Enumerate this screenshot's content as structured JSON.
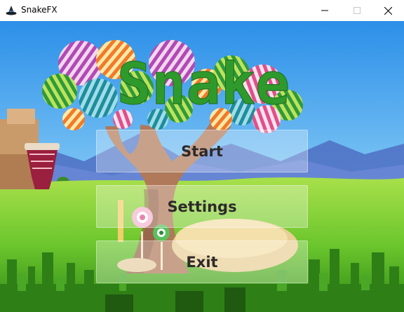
{
  "window": {
    "title": "SnakeFX",
    "icons": {
      "app": "wizard-hat-icon",
      "minimize": "minimize-icon",
      "maximize": "maximize-icon",
      "close": "close-icon"
    }
  },
  "game": {
    "logo": "Snake",
    "logo_color": "#2e9a2c",
    "menu": {
      "start_label": "Start",
      "settings_label": "Settings",
      "exit_label": "Exit"
    }
  }
}
